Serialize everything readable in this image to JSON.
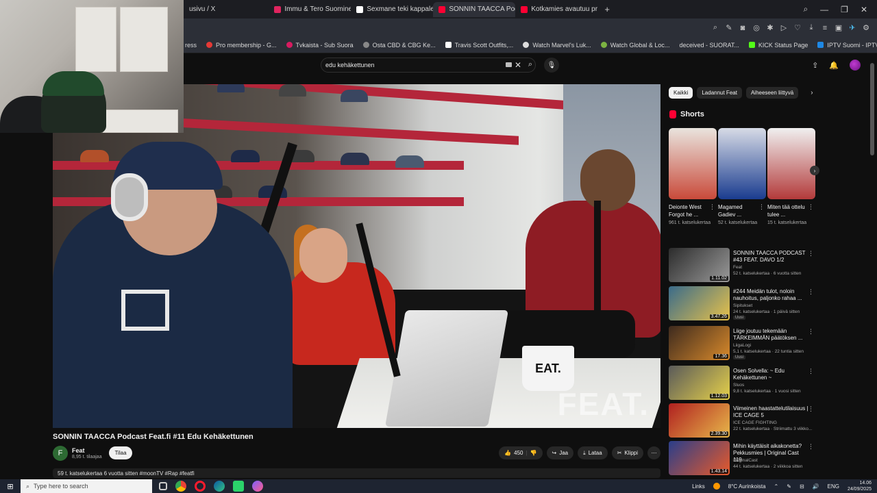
{
  "browser": {
    "tabs": [
      {
        "title": "usivu / X",
        "color": "#111111",
        "active": false
      },
      {
        "title": "Immu & Tero Suominen",
        "color": "#e0245e",
        "active": false
      },
      {
        "title": "Sexmane teki kappaleen",
        "color": "#ffffff",
        "active": false
      },
      {
        "title": "SONNIN TAACCA Pod",
        "color": "#ff0033",
        "active": true
      },
      {
        "title": "Kotkamies avautuu prism",
        "color": "#ff0033",
        "active": false
      }
    ],
    "new_tab": "+"
  },
  "bookmarks": [
    {
      "label": "Pro membership - G...",
      "color": "#e53935"
    },
    {
      "label": "Tvkaista - Sub Suora",
      "color": "#d81b60"
    },
    {
      "label": "Osta CBD & CBG Ke...",
      "color": "#888888"
    },
    {
      "label": "Travis Scott Outfits,...",
      "color": "#ffffff"
    },
    {
      "label": "Watch Marvel's Luk...",
      "color": "#dddddd"
    },
    {
      "label": "Watch Global & Loc...",
      "color": "#7cb342"
    },
    {
      "label": "deceived - SUORAT...",
      "color": "#bbbbbb"
    },
    {
      "label": "KICK Status Page",
      "color": "#53fc18"
    },
    {
      "label": "IPTV Suomi - IPTV-v...",
      "color": "#1e88e5"
    }
  ],
  "youtube": {
    "search_value": "edu kehäkettunen",
    "video": {
      "title": "SONNIN TAACCA Podcast Feat.fi #11 Edu Kehäkettunen",
      "watermark": "FEAT.",
      "mug_text": "EAT."
    },
    "channel": {
      "avatar_letter": "F",
      "name": "Feat",
      "subs": "8,95 t. tilaajaa",
      "subscribe_label": "Tilaa"
    },
    "actions": {
      "likes": "450",
      "share": "Jaa",
      "download": "Lataa",
      "clip": "Klippi"
    },
    "description": "59 t. katselukertaa  6 vuotta sitten  #moonTV #Rap #featfi",
    "chips": [
      "Kaikki",
      "Ladannut Feat",
      "Aiheeseen liittyvä"
    ],
    "shorts_title": "Shorts",
    "shorts": [
      {
        "title": "Deionte West Forgot he ...",
        "views": "961 t. katselukertaa",
        "colors": [
          "#e9e4de",
          "#c94a3a"
        ]
      },
      {
        "title": "Magamed Gadiev ...",
        "views": "52 t. katselukertaa",
        "colors": [
          "#1a3c8f",
          "#d7dbe6"
        ]
      },
      {
        "title": "Miten tää ottelu tulee ...",
        "views": "15 t. katselukertaa",
        "colors": [
          "#b33a3a",
          "#f0f0f0"
        ]
      }
    ],
    "recommended": [
      {
        "title": "SONNIN TAACCA PODCAST #43 FEAT. DAVO 1/2",
        "channel": "Feat",
        "meta": "52 t. katselukertaa · 6 vuotta sitten",
        "duration": "1.11.02",
        "badge": "",
        "colors": [
          "#2c2c2c",
          "#9a9a9a"
        ]
      },
      {
        "title": "#244 Meidän tulot, noloin nauhoitus, paljonko rahaa ...",
        "channel": "Sipitukset",
        "meta": "24 t. katselukertaa · 1 päivä sitten",
        "duration": "3.47.26",
        "badge": "Uusi",
        "colors": [
          "#3a6b8a",
          "#e8c24a"
        ]
      },
      {
        "title": "Liige joutuu tekemään TÄRKEIMMÄN päätöksen ...",
        "channel": "LiigaLogi",
        "meta": "5,1 t. katselukertaa · 22 tuntia sitten",
        "duration": "17.36",
        "badge": "Uusi",
        "colors": [
          "#3d2a1e",
          "#d98a2b"
        ]
      },
      {
        "title": "Osen Solvella: ~ Edu Kehäkettunen ~",
        "channel": "Sluos",
        "meta": "9,8 t. katselukertaa · 1 vuosi sitten",
        "duration": "1.12.03",
        "badge": "",
        "colors": [
          "#5a5a5a",
          "#e6d14a"
        ]
      },
      {
        "title": "Viimeinen haastattelutilaisuus | ICE CAGE 5",
        "channel": "ICE CAGE FIGHTING",
        "meta": "22 t. katselukertaa · Striimattu 3 viikko...",
        "duration": "2.39.30",
        "badge": "",
        "colors": [
          "#b02020",
          "#e8b84a"
        ]
      },
      {
        "title": "Mihin käyttäisit aikakonetta? Pekkusmies | Original Cast 119",
        "channel": "OriginalCast",
        "meta": "44 t. katselukertaa · 2 viikkoa sitten",
        "duration": "1.43.14",
        "badge": "",
        "colors": [
          "#2a3e8a",
          "#e85a2a"
        ]
      }
    ]
  },
  "taskbar": {
    "search_placeholder": "Type here to search",
    "links": "Links",
    "weather": "8°C  Aurinkoista",
    "lang": "ENG",
    "time": "14.06",
    "date": "24/09/2025"
  }
}
